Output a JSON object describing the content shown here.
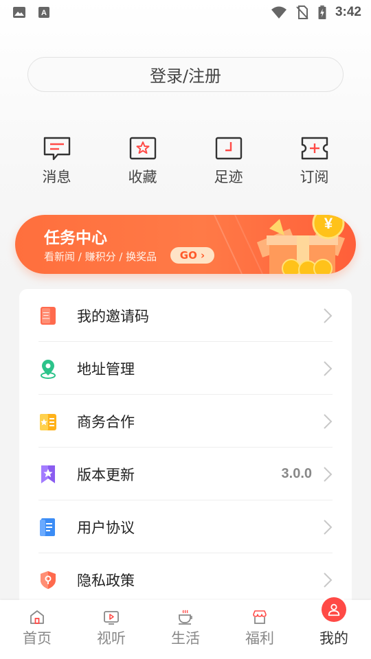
{
  "status_bar": {
    "time": "3:42",
    "left_icons": [
      "image-icon",
      "font-icon"
    ],
    "right_icons": [
      "wifi-icon",
      "no-sim-icon",
      "battery-charging-icon"
    ]
  },
  "login": {
    "label": "登录/注册"
  },
  "quick_actions": [
    {
      "label": "消息",
      "icon": "message-icon"
    },
    {
      "label": "收藏",
      "icon": "star-icon"
    },
    {
      "label": "足迹",
      "icon": "footprint-icon"
    },
    {
      "label": "订阅",
      "icon": "subscribe-ticket-icon"
    }
  ],
  "task_banner": {
    "title": "任务中心",
    "subtitle": "看新闻 / 赚积分 / 换奖品",
    "go_label": "GO ›",
    "coin_symbol": "¥"
  },
  "menu": [
    {
      "label": "我的邀请码",
      "icon": "invite-code-icon",
      "value": ""
    },
    {
      "label": "地址管理",
      "icon": "location-pin-icon",
      "value": ""
    },
    {
      "label": "商务合作",
      "icon": "business-card-icon",
      "value": ""
    },
    {
      "label": "版本更新",
      "icon": "version-bookmark-icon",
      "value": "3.0.0"
    },
    {
      "label": "用户协议",
      "icon": "document-icon",
      "value": ""
    },
    {
      "label": "隐私政策",
      "icon": "privacy-shield-icon",
      "value": ""
    }
  ],
  "bottom_nav": [
    {
      "label": "首页",
      "icon": "home-icon",
      "active": false
    },
    {
      "label": "视听",
      "icon": "video-icon",
      "active": false
    },
    {
      "label": "生活",
      "icon": "coffee-icon",
      "active": false
    },
    {
      "label": "福利",
      "icon": "shop-icon",
      "active": false
    },
    {
      "label": "我的",
      "icon": "user-icon",
      "active": true
    }
  ],
  "colors": {
    "accent": "#ff5f39",
    "banner_start": "#ff6f3d",
    "active_tab": "#ff4a46"
  }
}
